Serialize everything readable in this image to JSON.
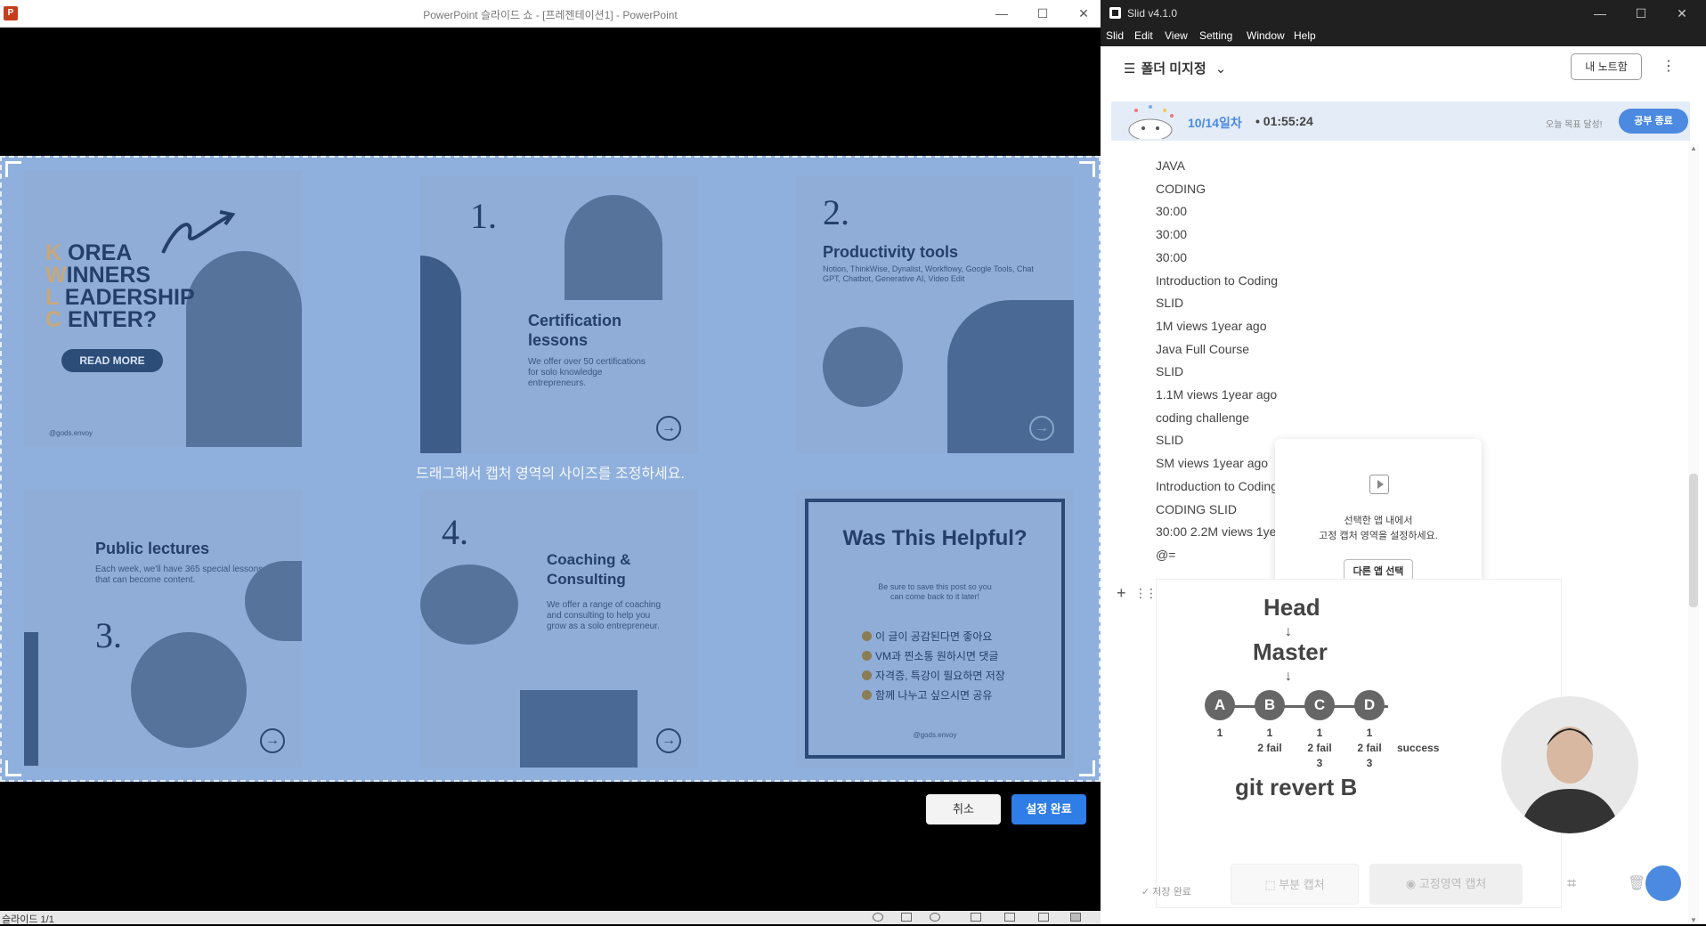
{
  "ppt": {
    "window_title": "PowerPoint 슬라이드 쇼 - [프레젠테이션1] - PowerPoint",
    "app_icon": "P",
    "minimize": "—",
    "maximize": "☐",
    "close": "✕",
    "status_slide": "슬라이드 1/1",
    "drag_hint": "드래그해서 캡처 영역의 사이즈를 조정하세요.",
    "cancel_label": "취소",
    "done_label": "설정 완료"
  },
  "slides": {
    "card1": {
      "kwlc_letters": [
        "K",
        "W",
        "L",
        "C"
      ],
      "kwlc_words": [
        "OREA",
        "INNERS",
        "EADERSHIP",
        "ENTER?"
      ],
      "read_more": "READ MORE",
      "handle": "@gods.envoy"
    },
    "card2": {
      "num": "1.",
      "heading": "Certification lessons",
      "body": "We offer over 50 certifications for solo knowledge entrepreneurs."
    },
    "card3": {
      "num": "2.",
      "heading": "Productivity tools",
      "body": "Notion, ThinkWise, Dynalist, Workflowy, Google Tools, Chat GPT, Chatbot, Generative AI, Video Edit"
    },
    "card4": {
      "num": "3.",
      "heading": "Public lectures",
      "body": "Each week, we'll have 365 special lessons that can become content."
    },
    "card5": {
      "num": "4.",
      "heading": "Coaching & Consulting",
      "body": "We offer a range of coaching and consulting to help you grow as a solo entrepreneur."
    },
    "card6": {
      "heading": "Was This Helpful?",
      "body": "Be sure to save this post so you can come back to it later!",
      "items": [
        "이 글이 공감된다면 좋아요",
        "VM과 찐소통 원하시면 댓글",
        "자격증, 특강이 필요하면 저장",
        "함께 나누고 싶으시면 공유"
      ],
      "handle": "@gods.envoy"
    }
  },
  "slid": {
    "window_title": "Slid v4.1.0",
    "menu": [
      "Slid",
      "Edit",
      "View",
      "Setting",
      "Window",
      "Help"
    ],
    "folder_label": "폴더 미지정",
    "notebook_btn": "내 노트함",
    "study_day": "10/14일차",
    "study_time": "01:55:24",
    "goal_text": "오늘 목표 달성!",
    "end_btn": "공부 종료",
    "note_lines": [
      "JAVA",
      "CODING",
      "30:00",
      "30:00",
      "30:00",
      "Introduction to Coding",
      "SLID",
      "1M views 1year ago",
      "Java Full Course",
      "SLID",
      "1.1M views 1year ago",
      "coding challenge",
      "SLID",
      "SM views 1year ago",
      "Introduction to Coding",
      "CODING SLID",
      "30:00 2.2M views 1year ago",
      "@="
    ],
    "popup_msg_1": "선택한 앱 내에서",
    "popup_msg_2": "고정 캡처 영역을 설정하세요.",
    "popup_btn": "다른 앱 선택",
    "diagram": {
      "head": "Head",
      "master": "Master",
      "nodes": [
        "A",
        "B",
        "C",
        "D"
      ],
      "labels": [
        [
          "1"
        ],
        [
          "1",
          "2 fail"
        ],
        [
          "1",
          "2 fail",
          "3"
        ],
        [
          "1",
          "2 fail",
          "3"
        ]
      ],
      "success": "success",
      "caption": "git revert B"
    },
    "partial_capture": "부분 캡처",
    "fixed_capture": "고정영역 캡처",
    "saved": "저장 완료"
  }
}
